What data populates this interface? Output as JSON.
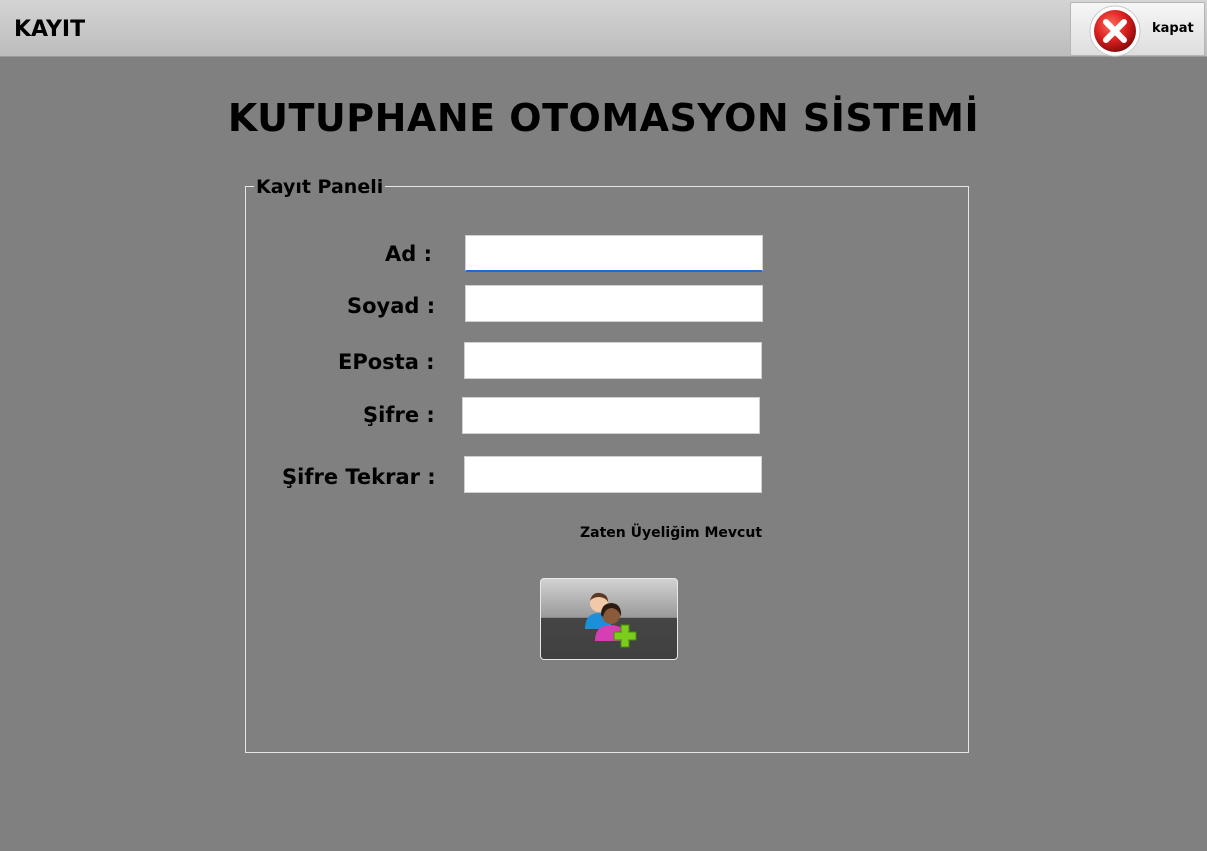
{
  "window": {
    "title": "KAYIT",
    "close_label": "kapat"
  },
  "app_title": "KUTUPHANE OTOMASYON SİSTEMİ",
  "panel": {
    "legend": "Kayıt Paneli",
    "fields": [
      {
        "label": "Ad :",
        "value": ""
      },
      {
        "label": "Soyad :",
        "value": ""
      },
      {
        "label": "EPosta :",
        "value": ""
      },
      {
        "label": "Şifre :",
        "value": ""
      },
      {
        "label": "Şifre Tekrar :",
        "value": ""
      }
    ],
    "login_link": "Zaten Üyeliğim Mevcut",
    "register_icon": "user-add-icon"
  },
  "colors": {
    "background": "#808080",
    "focus_accent": "#1c6bd1",
    "close_red": "#d81e1e",
    "add_green": "#7ccc1e"
  }
}
